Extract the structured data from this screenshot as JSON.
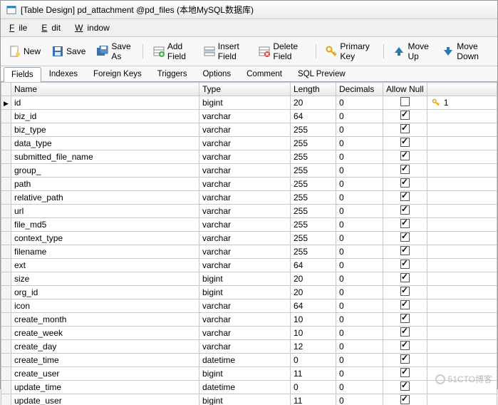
{
  "titlebar": "[Table Design] pd_attachment @pd_files (本地MySQL数据库)",
  "menu": {
    "file": "File",
    "edit": "Edit",
    "window": "Window"
  },
  "toolbar": {
    "new": "New",
    "save": "Save",
    "saveas": "Save As",
    "addfield": "Add Field",
    "insertfield": "Insert Field",
    "deletefield": "Delete Field",
    "primarykey": "Primary Key",
    "moveup": "Move Up",
    "movedown": "Move Down"
  },
  "tabs": {
    "fields": "Fields",
    "indexes": "Indexes",
    "foreignkeys": "Foreign Keys",
    "triggers": "Triggers",
    "options": "Options",
    "comment": "Comment",
    "sqlpreview": "SQL Preview"
  },
  "headers": {
    "name": "Name",
    "type": "Type",
    "length": "Length",
    "decimals": "Decimals",
    "allownull": "Allow Null",
    "key": ""
  },
  "watermark": "51CTO博客",
  "pk_label": "1",
  "rows": [
    {
      "name": "id",
      "type": "bigint",
      "len": "20",
      "dec": "0",
      "null": false,
      "pk": true,
      "selected": true
    },
    {
      "name": "biz_id",
      "type": "varchar",
      "len": "64",
      "dec": "0",
      "null": true
    },
    {
      "name": "biz_type",
      "type": "varchar",
      "len": "255",
      "dec": "0",
      "null": true
    },
    {
      "name": "data_type",
      "type": "varchar",
      "len": "255",
      "dec": "0",
      "null": true
    },
    {
      "name": "submitted_file_name",
      "type": "varchar",
      "len": "255",
      "dec": "0",
      "null": true
    },
    {
      "name": "group_",
      "type": "varchar",
      "len": "255",
      "dec": "0",
      "null": true
    },
    {
      "name": "path",
      "type": "varchar",
      "len": "255",
      "dec": "0",
      "null": true
    },
    {
      "name": "relative_path",
      "type": "varchar",
      "len": "255",
      "dec": "0",
      "null": true
    },
    {
      "name": "url",
      "type": "varchar",
      "len": "255",
      "dec": "0",
      "null": true
    },
    {
      "name": "file_md5",
      "type": "varchar",
      "len": "255",
      "dec": "0",
      "null": true
    },
    {
      "name": "context_type",
      "type": "varchar",
      "len": "255",
      "dec": "0",
      "null": true
    },
    {
      "name": "filename",
      "type": "varchar",
      "len": "255",
      "dec": "0",
      "null": true
    },
    {
      "name": "ext",
      "type": "varchar",
      "len": "64",
      "dec": "0",
      "null": true
    },
    {
      "name": "size",
      "type": "bigint",
      "len": "20",
      "dec": "0",
      "null": true
    },
    {
      "name": "org_id",
      "type": "bigint",
      "len": "20",
      "dec": "0",
      "null": true
    },
    {
      "name": "icon",
      "type": "varchar",
      "len": "64",
      "dec": "0",
      "null": true
    },
    {
      "name": "create_month",
      "type": "varchar",
      "len": "10",
      "dec": "0",
      "null": true
    },
    {
      "name": "create_week",
      "type": "varchar",
      "len": "10",
      "dec": "0",
      "null": true
    },
    {
      "name": "create_day",
      "type": "varchar",
      "len": "12",
      "dec": "0",
      "null": true
    },
    {
      "name": "create_time",
      "type": "datetime",
      "len": "0",
      "dec": "0",
      "null": true
    },
    {
      "name": "create_user",
      "type": "bigint",
      "len": "11",
      "dec": "0",
      "null": true
    },
    {
      "name": "update_time",
      "type": "datetime",
      "len": "0",
      "dec": "0",
      "null": true
    },
    {
      "name": "update_user",
      "type": "bigint",
      "len": "11",
      "dec": "0",
      "null": true
    }
  ]
}
